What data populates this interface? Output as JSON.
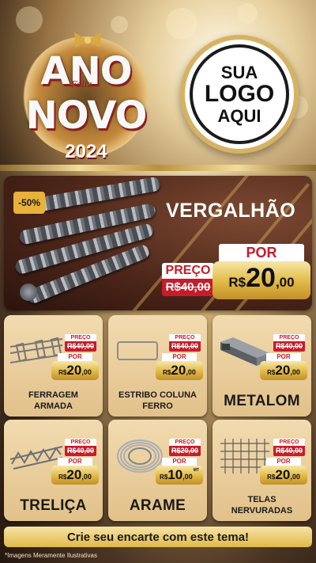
{
  "header": {
    "badge": {
      "line1": "ANO",
      "line2": "NOVO",
      "feliz": "Feliz",
      "year": "2024"
    },
    "logo": {
      "line1": "SUA",
      "line2": "LOGO",
      "line3": "AQUI"
    }
  },
  "hero": {
    "discount": "-50%",
    "title": "VERGALHÃO",
    "old_label": "PREÇO",
    "old_price": "R$40,00",
    "new_label": "POR",
    "new_currency": "R$",
    "new_int": "20",
    "new_cents": ",00"
  },
  "products": [
    {
      "name_lines": [
        "FERRAGEM",
        "ARMADA"
      ],
      "old_label": "PREÇO",
      "old_price": "R$40,00",
      "new_label": "POR",
      "currency": "R$",
      "int": "20",
      "cents": ",00",
      "unit": ""
    },
    {
      "name_lines": [
        "ESTRIBO COLUNA",
        "FERRO"
      ],
      "old_label": "PREÇO",
      "old_price": "R$40,00",
      "new_label": "POR",
      "currency": "R$",
      "int": "20",
      "cents": ",00",
      "unit": ""
    },
    {
      "name_lines": [
        "METALOM"
      ],
      "old_label": "PREÇO",
      "old_price": "R$40,00",
      "new_label": "POR",
      "currency": "R$",
      "int": "20",
      "cents": ",00",
      "unit": ""
    },
    {
      "name_lines": [
        "TRELIÇA"
      ],
      "old_label": "PREÇO",
      "old_price": "R$40,00",
      "new_label": "POR",
      "currency": "R$",
      "int": "20",
      "cents": ",00",
      "unit": ""
    },
    {
      "name_lines": [
        "ARAME"
      ],
      "old_label": "PREÇO",
      "old_price": "R$20,00",
      "new_label": "POR",
      "currency": "R$",
      "int": "10",
      "cents": ",00",
      "unit": "MT"
    },
    {
      "name_lines": [
        "TELAS",
        "NERVURADAS"
      ],
      "old_label": "PREÇO",
      "old_price": "R$40,00",
      "new_label": "POR",
      "currency": "R$",
      "int": "20",
      "cents": ",00",
      "unit": ""
    }
  ],
  "cta": "Crie seu encarte com este tema!",
  "disclaimer": "*Imagens Meramente Ilustrativas",
  "colors": {
    "gold": "#e1b844",
    "red": "#c51d2a",
    "brown": "#4a2418",
    "card": "#e2c18a"
  }
}
